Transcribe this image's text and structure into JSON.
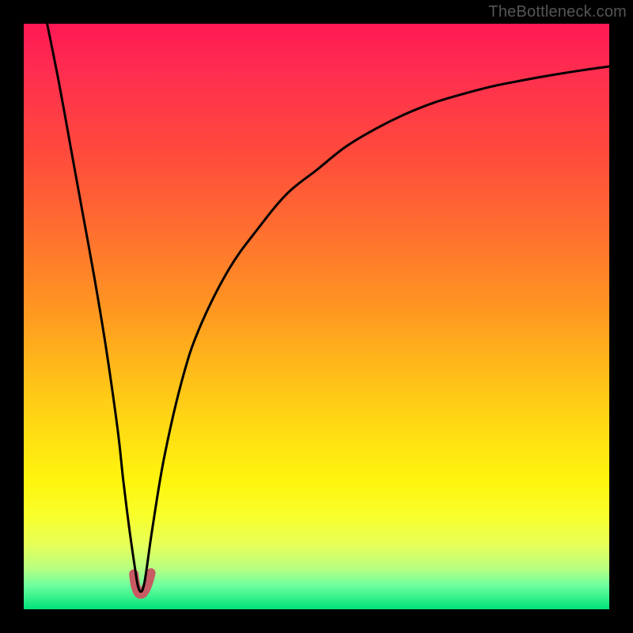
{
  "credit_text": "TheBottleneck.com",
  "chart_data": {
    "type": "line",
    "title": "",
    "xlabel": "",
    "ylabel": "",
    "xlim": [
      0,
      100
    ],
    "ylim": [
      0,
      100
    ],
    "series": [
      {
        "name": "curve",
        "x": [
          4,
          6,
          8,
          10,
          12,
          14,
          16,
          17,
          18,
          19,
          19.5,
          20,
          20.5,
          21,
          22,
          24,
          27,
          30,
          35,
          40,
          45,
          50,
          55,
          60,
          65,
          70,
          75,
          80,
          85,
          90,
          95,
          100
        ],
        "y": [
          100,
          90,
          79,
          68,
          57,
          45,
          31,
          22,
          14,
          7,
          4,
          3,
          4,
          7,
          14,
          26,
          39,
          48,
          58,
          65,
          71,
          75,
          79,
          82,
          84.5,
          86.5,
          88,
          89.3,
          90.3,
          91.2,
          92,
          92.7
        ]
      },
      {
        "name": "marker",
        "x": [
          18.8,
          19.0,
          19.3,
          19.6,
          20.0,
          20.4,
          20.8,
          21.2,
          21.5,
          21.7
        ],
        "y": [
          6.0,
          4.5,
          3.4,
          2.8,
          2.6,
          2.8,
          3.4,
          4.4,
          5.4,
          6.2
        ]
      }
    ],
    "colors": {
      "curve": "#000000",
      "marker": "#c85a63"
    }
  }
}
